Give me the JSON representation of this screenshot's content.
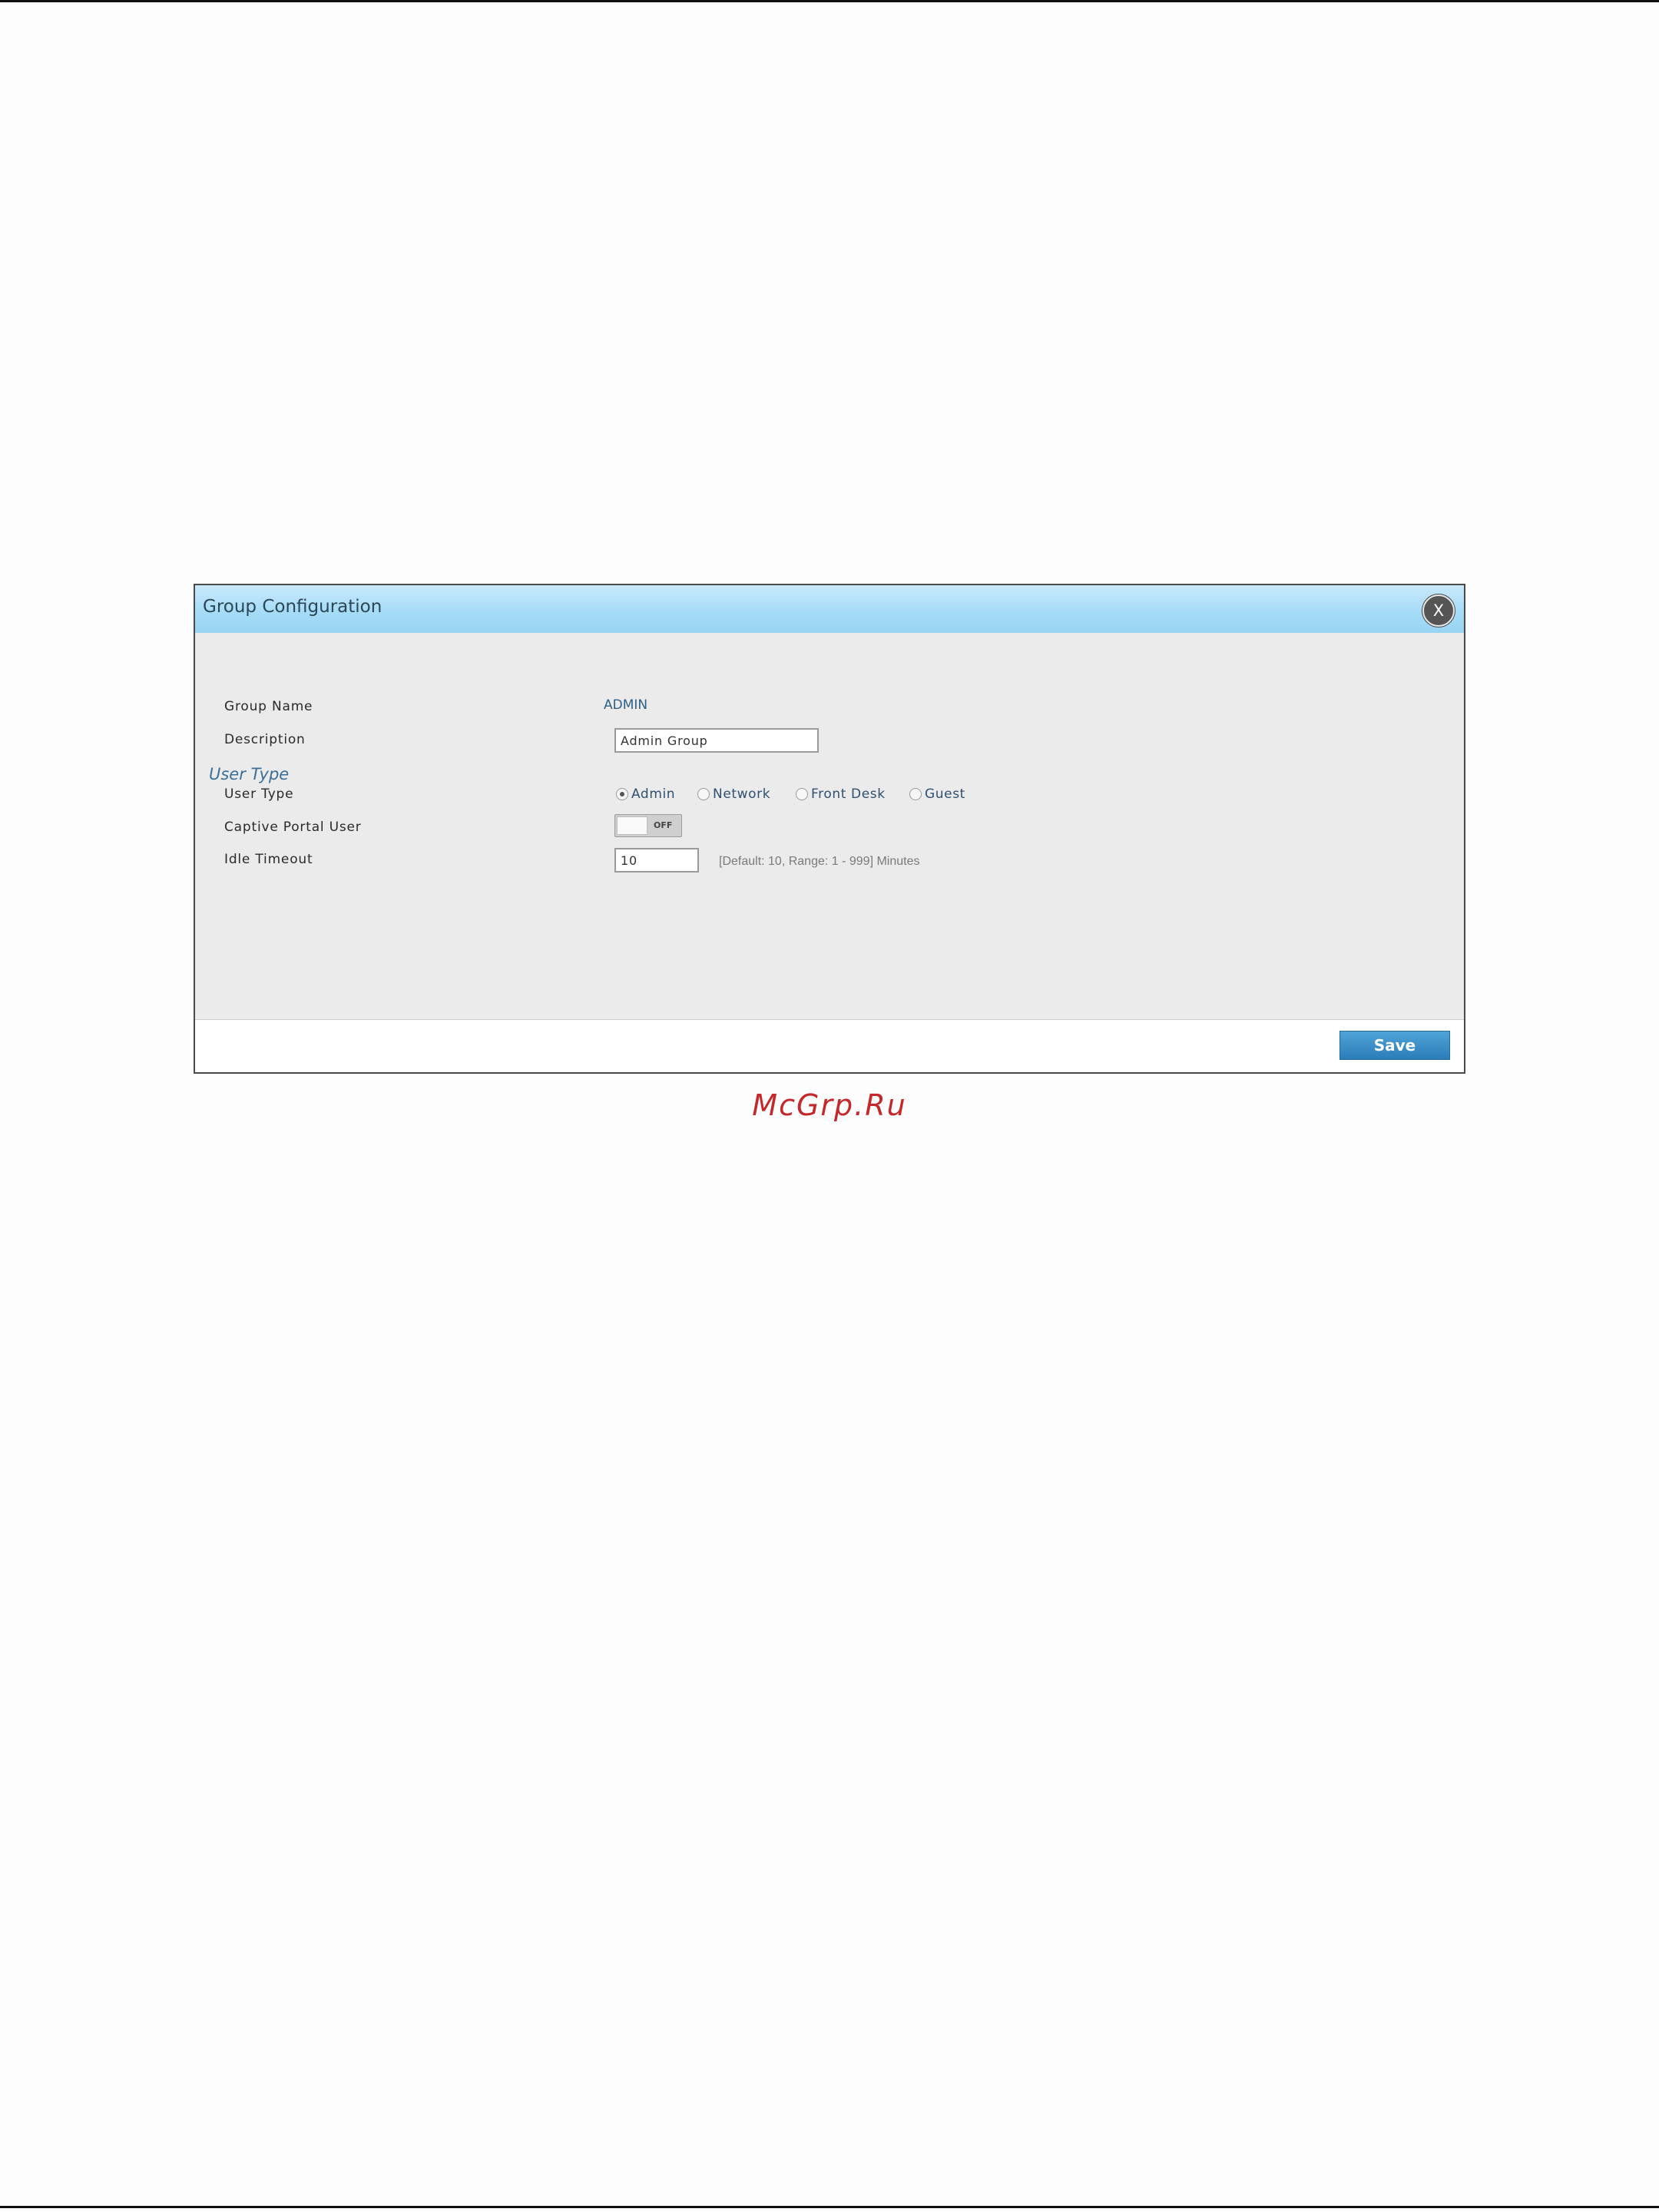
{
  "dialog": {
    "title": "Group Configuration",
    "close_label": "X",
    "fields": {
      "group_name_label": "Group Name",
      "group_name_value": "ADMIN",
      "description_label": "Description",
      "description_value": "Admin Group",
      "section_heading": "User Type",
      "user_type_label": "User Type",
      "user_type_options": [
        "Admin",
        "Network",
        "Front Desk",
        "Guest"
      ],
      "user_type_selected": "Admin",
      "captive_portal_label": "Captive Portal User",
      "captive_portal_state": "OFF",
      "idle_timeout_label": "Idle Timeout",
      "idle_timeout_value": "10",
      "idle_timeout_hint": "[Default: 10, Range: 1 - 999] Minutes"
    },
    "save_label": "Save"
  },
  "watermark": "McGrp.Ru",
  "colors": {
    "header_blue": "#a6dcf7",
    "body_gray": "#ebebeb",
    "save_button": "#2b7db7",
    "watermark_red": "#c4282b"
  }
}
